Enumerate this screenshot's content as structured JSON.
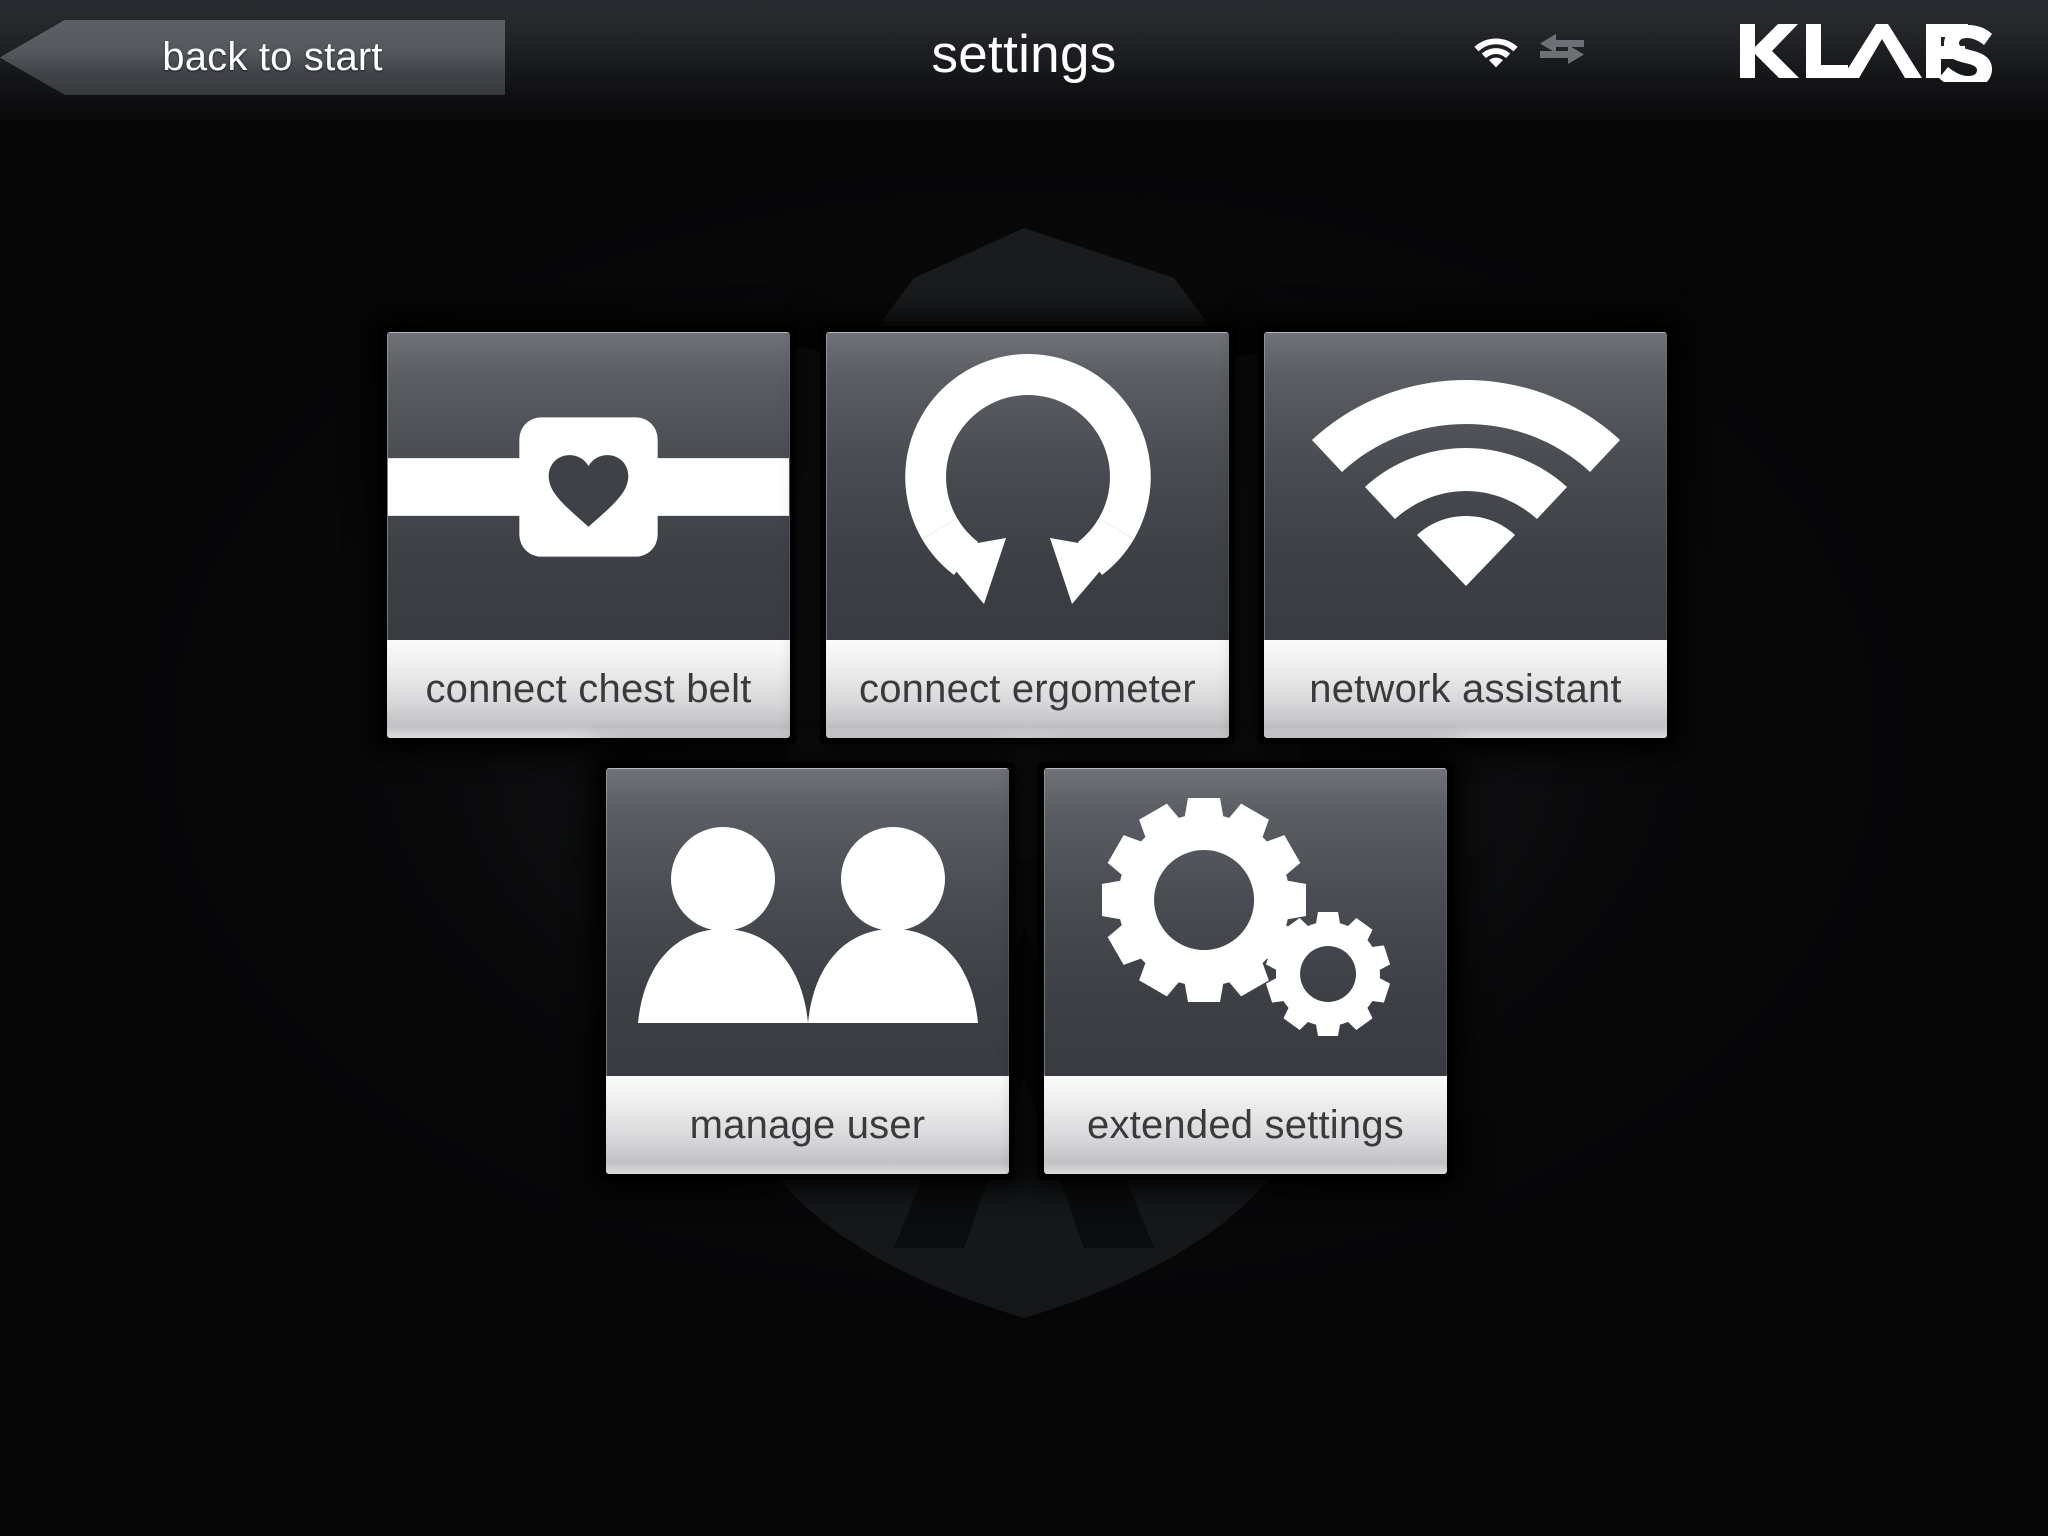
{
  "header": {
    "back_button": {
      "label": "back to start",
      "icon": "chevron-left-icon"
    },
    "title": "settings",
    "status": {
      "wifi": {
        "icon": "wifi-icon",
        "state": "connected-full"
      },
      "sync": {
        "icon": "data-transfer-arrows-icon",
        "state": "idle"
      }
    },
    "brand": {
      "name": "KLAFS",
      "icon": "klafs-logo"
    }
  },
  "main": {
    "tiles": [
      {
        "id": "connect-chest-belt",
        "label": "connect chest belt",
        "icon": "heart-chest-belt-icon"
      },
      {
        "id": "connect-ergometer",
        "label": "connect ergometer",
        "icon": "circular-refresh-arrows-icon"
      },
      {
        "id": "network-assistant",
        "label": "network assistant",
        "icon": "wifi-signal-icon"
      },
      {
        "id": "manage-user",
        "label": "manage user",
        "icon": "two-users-icon"
      },
      {
        "id": "extended-settings",
        "label": "extended settings",
        "icon": "two-gears-icon"
      }
    ]
  },
  "colors": {
    "background": "#050506",
    "tile_icon_top": "#6f7276",
    "tile_icon_bottom": "#383c40",
    "tile_label_top": "#fbfbfc",
    "tile_label_bottom": "#c2c2c5",
    "tile_label_text": "#3a3a3c",
    "header_text": "#ffffff",
    "accent_white": "#ffffff"
  }
}
